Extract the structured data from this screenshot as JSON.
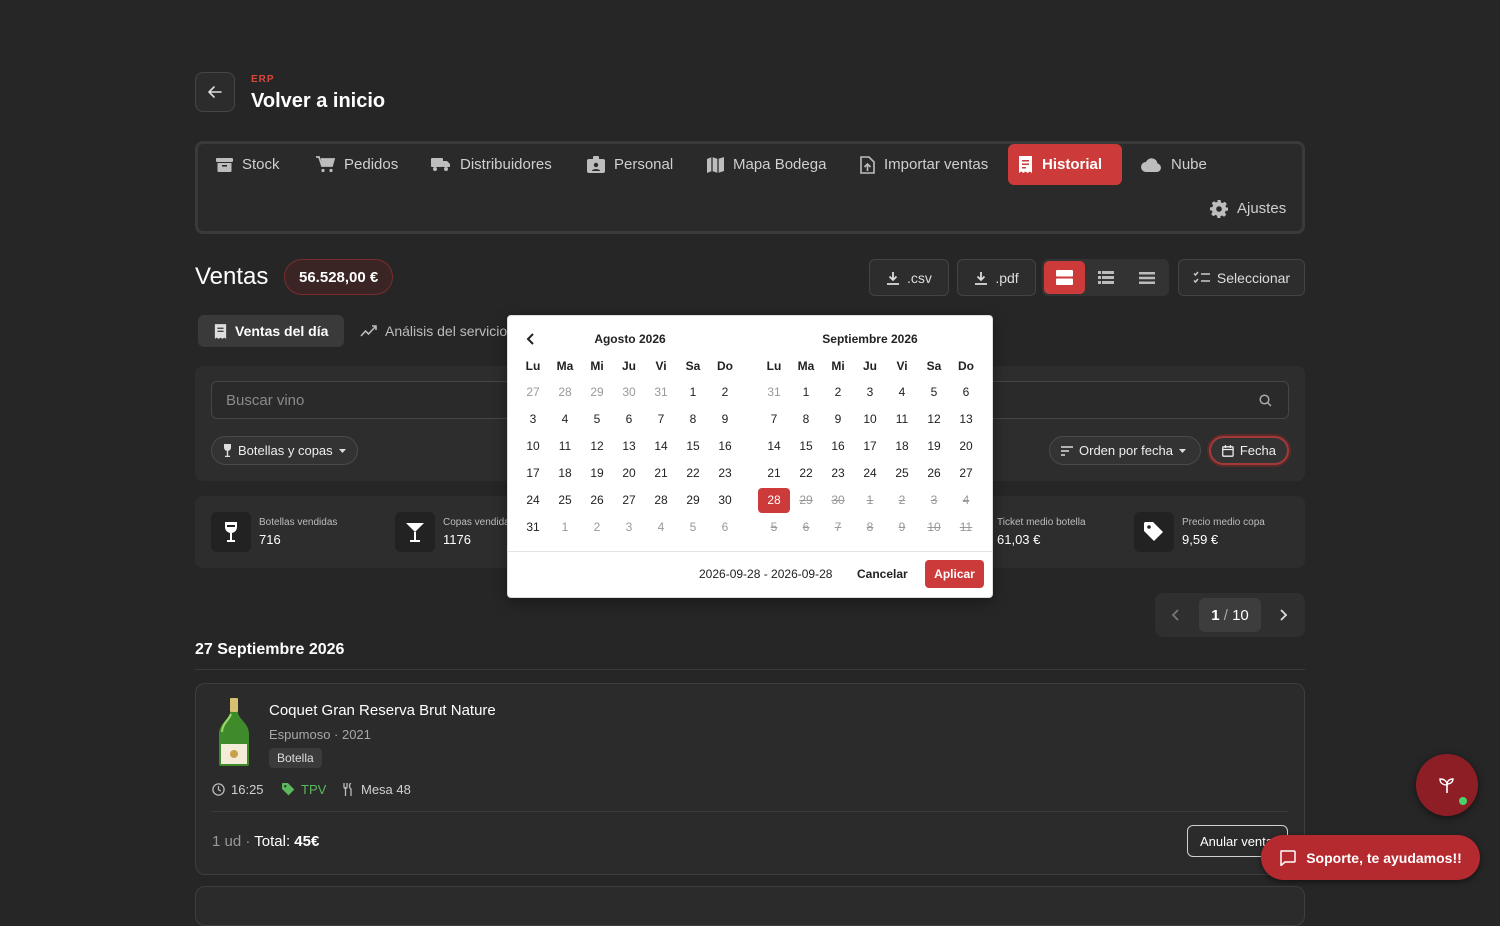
{
  "header": {
    "eyebrow": "ERP",
    "title": "Volver a inicio"
  },
  "nav": {
    "items": [
      {
        "label": "Stock",
        "icon": "archive-icon"
      },
      {
        "label": "Pedidos",
        "icon": "cart-icon"
      },
      {
        "label": "Distribuidores",
        "icon": "truck-icon"
      },
      {
        "label": "Personal",
        "icon": "id-badge-icon"
      },
      {
        "label": "Mapa Bodega",
        "icon": "map-icon"
      },
      {
        "label": "Importar ventas",
        "icon": "file-import-icon"
      },
      {
        "label": "Historial",
        "icon": "receipt-icon",
        "active": true
      },
      {
        "label": "Nube",
        "icon": "cloud-icon"
      }
    ],
    "settings_label": "Ajustes"
  },
  "sales": {
    "title": "Ventas",
    "total": "56.528,00 €",
    "csv_label": ".csv",
    "pdf_label": ".pdf",
    "select_label": "Seleccionar"
  },
  "tabs": [
    {
      "label": "Ventas del día",
      "active": true
    },
    {
      "label": "Análisis del servicio",
      "active": false
    }
  ],
  "filters": {
    "search_placeholder": "Buscar vino",
    "type_label": "Botellas y copas",
    "order_label": "Orden por fecha",
    "date_label": "Fecha"
  },
  "stats": [
    {
      "label": "Botellas vendidas",
      "value": "716",
      "icon": "wine-bottle-icon"
    },
    {
      "label": "Copas vendidas",
      "value": "1176",
      "icon": "cocktail-glass-icon"
    },
    {
      "label": "Ticket medio botella",
      "value": "61,03 €"
    },
    {
      "label": "Precio medio copa",
      "value": "9,59 €",
      "icon": "tag-icon"
    }
  ],
  "pager": {
    "current": "1",
    "separator": "/",
    "total": "10"
  },
  "groups": [
    {
      "date": "27 Septiembre 2026",
      "sales": [
        {
          "name": "Coquet Gran Reserva Brut Nature",
          "subtitle": "Espumoso · 2021",
          "badge": "Botella",
          "time": "16:25",
          "channel": "TPV",
          "table": "Mesa 48",
          "qty": "1 ud · ",
          "total_label": "Total: ",
          "total_value": "45€",
          "cancel_label": "Anular venta"
        }
      ]
    }
  ],
  "calendar": {
    "dow": [
      "Lu",
      "Ma",
      "Mi",
      "Ju",
      "Vi",
      "Sa",
      "Do"
    ],
    "months": [
      {
        "title": "Agosto 2026",
        "weeks": [
          [
            "27",
            "28",
            "29",
            "30",
            "31",
            "1",
            "2"
          ],
          [
            "3",
            "4",
            "5",
            "6",
            "7",
            "8",
            "9"
          ],
          [
            "10",
            "11",
            "12",
            "13",
            "14",
            "15",
            "16"
          ],
          [
            "17",
            "18",
            "19",
            "20",
            "21",
            "22",
            "23"
          ],
          [
            "24",
            "25",
            "26",
            "27",
            "28",
            "29",
            "30"
          ],
          [
            "31",
            "1",
            "2",
            "3",
            "4",
            "5",
            "6"
          ]
        ],
        "outside_first_row": 5,
        "outside_last_row_after": 1
      },
      {
        "title": "Septiembre 2026",
        "weeks": [
          [
            "31",
            "1",
            "2",
            "3",
            "4",
            "5",
            "6"
          ],
          [
            "7",
            "8",
            "9",
            "10",
            "11",
            "12",
            "13"
          ],
          [
            "14",
            "15",
            "16",
            "17",
            "18",
            "19",
            "20"
          ],
          [
            "21",
            "22",
            "23",
            "24",
            "25",
            "26",
            "27"
          ],
          [
            "28",
            "29",
            "30",
            "1",
            "2",
            "3",
            "4"
          ],
          [
            "5",
            "6",
            "7",
            "8",
            "9",
            "10",
            "11"
          ]
        ],
        "selected": "28"
      }
    ],
    "range": "2026-09-28 - 2026-09-28",
    "cancel_label": "Cancelar",
    "apply_label": "Aplicar"
  },
  "support": {
    "label": "Soporte, te ayudamos!!"
  },
  "colors": {
    "accent": "#cc3a3a",
    "background": "#262626",
    "channel": "#5cb85c"
  }
}
